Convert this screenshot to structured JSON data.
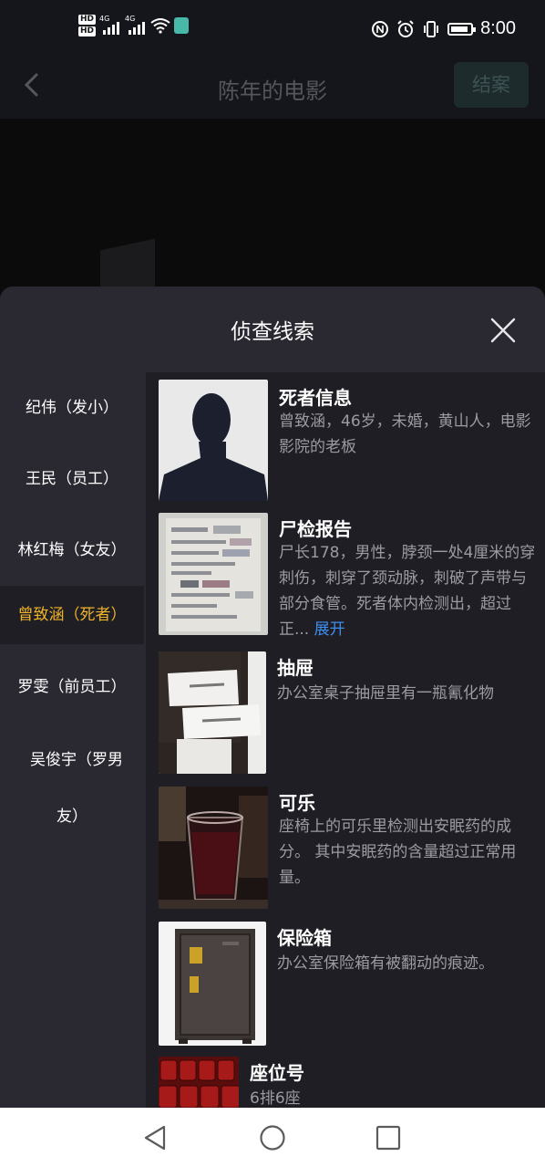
{
  "status_bar": {
    "time": "8:00",
    "hd1": "HD",
    "hd2": "HD",
    "net1": "4G",
    "net2": "4G",
    "icons": [
      "signal-icon",
      "wifi-icon",
      "nfc-icon",
      "alarm-icon",
      "vibrate-icon",
      "battery-icon"
    ]
  },
  "header": {
    "title": "陈年的电影",
    "close_case_label": "结案"
  },
  "sheet": {
    "title": "侦查线索",
    "suspects": [
      {
        "label": "纪伟（发小）"
      },
      {
        "label": "王民（员工）"
      },
      {
        "label": "林红梅（女友）"
      },
      {
        "label": "曾致涵（死者）",
        "active": true
      },
      {
        "label": "罗雯（前员工）"
      },
      {
        "label_line1": "吴俊宇（罗男",
        "label_line2": "友）"
      }
    ],
    "clues": [
      {
        "title": "死者信息",
        "description": "曾致涵，46岁，未婚，黄山人，电影影院的老板",
        "image": "silhouette"
      },
      {
        "title": "尸检报告",
        "description": "尸长178，男性，脖颈一处4厘米的穿刺伤，刺穿了颈动脉，刺破了声带与部分食管。死者体内检测出，超过正...",
        "expand_label": "展开",
        "image": "document"
      },
      {
        "title": "抽屉",
        "description": "办公室桌子抽屉里有一瓶氰化物",
        "image": "drawer"
      },
      {
        "title": "可乐",
        "description": "座椅上的可乐里检测出安眠药的成分。 其中安眠药的含量超过正常用量。",
        "image": "cola-glass"
      },
      {
        "title": "保险箱",
        "description": "办公室保险箱有被翻动的痕迹。",
        "image": "safe"
      },
      {
        "title": "座位号",
        "description": "6排6座",
        "image": "cinema-seats"
      }
    ]
  },
  "colors": {
    "accent": "#f0b429",
    "link": "#3d8ef0",
    "sheet_bg": "#2a2932",
    "list_bg": "#1f1e25"
  }
}
